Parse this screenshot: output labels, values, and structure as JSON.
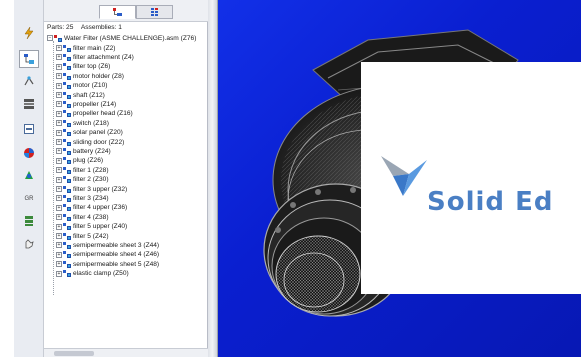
{
  "panel": {
    "parts_label": "Parts: 25",
    "assemblies_label": "Assemblies: 1",
    "tabs": [
      {
        "name": "tree-view-icon"
      },
      {
        "name": "grid-view-icon"
      }
    ]
  },
  "tree": {
    "root": "Water Filter (ASME CHALLENGE).asm  (Z76)",
    "items": [
      {
        "label": "filter main  (Z2)"
      },
      {
        "label": "filter attachment  (Z4)"
      },
      {
        "label": "filter top  (Z6)"
      },
      {
        "label": "motor holder  (Z8)"
      },
      {
        "label": "motor  (Z10)"
      },
      {
        "label": "shaft  (Z12)"
      },
      {
        "label": "propeller  (Z14)"
      },
      {
        "label": "propeller head  (Z16)"
      },
      {
        "label": "switch  (Z18)"
      },
      {
        "label": "solar panel  (Z20)"
      },
      {
        "label": "sliding door  (Z22)"
      },
      {
        "label": "battery  (Z24)"
      },
      {
        "label": "plug  (Z26)"
      },
      {
        "label": "filter 1  (Z28)"
      },
      {
        "label": "filter 2  (Z30)"
      },
      {
        "label": "filter 3 upper  (Z32)"
      },
      {
        "label": "filter 3  (Z34)"
      },
      {
        "label": "filter 4 upper  (Z36)"
      },
      {
        "label": "filter 4  (Z38)"
      },
      {
        "label": "filter 5 upper  (Z40)"
      },
      {
        "label": "filter 5  (Z42)"
      },
      {
        "label": "semipermeable sheet 3  (Z44)"
      },
      {
        "label": "semipermeable sheet 4  (Z46)"
      },
      {
        "label": "semipermeable sheet 5  (Z48)"
      },
      {
        "label": "elastic clamp  (Z50)"
      }
    ]
  },
  "left_strip": {
    "icons": [
      "lightning-icon",
      "tree-structure-icon",
      "relationship-icon",
      "layer-grid-icon",
      "sheet-icon",
      "color-globe-icon",
      "display-palette-icon",
      "gr-label-icon",
      "library-stack-icon",
      "hand-tool-icon"
    ],
    "gr_label": "GR"
  },
  "splash": {
    "brand_text": "Solid Ed"
  },
  "colors": {
    "viewport_blue": "#1230e8",
    "brand_blue": "#4a7fc4",
    "panel_bg": "#ffffff"
  }
}
